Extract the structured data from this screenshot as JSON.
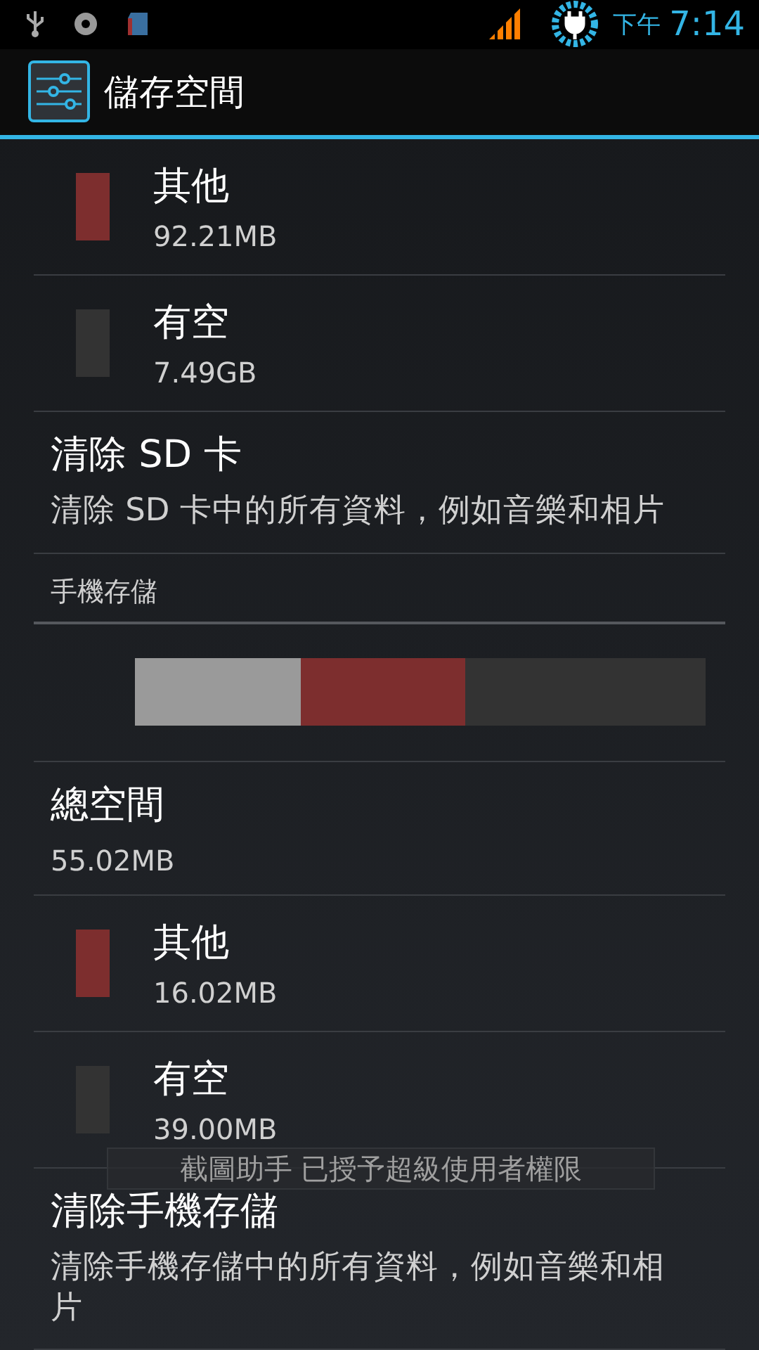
{
  "status_bar": {
    "period": "下午",
    "time": "7:14"
  },
  "action_bar": {
    "title": "儲存空間"
  },
  "items": [
    {
      "kind": "legend",
      "label": "其他",
      "value": "92.21MB",
      "color": "#7d2e2e"
    },
    {
      "kind": "legend",
      "label": "有空",
      "value": "7.49GB",
      "color": "#333333"
    },
    {
      "kind": "action",
      "title": "清除 SD 卡",
      "summary": "清除 SD 卡中的所有資料，例如音樂和相片"
    },
    {
      "kind": "header",
      "title": "手機存儲"
    },
    {
      "kind": "bar",
      "color": "#333333",
      "segments": [
        {
          "color": "#7d2e2e",
          "level": 0.58
        },
        {
          "color": "#9a9a9a",
          "level": 0.29
        }
      ]
    },
    {
      "kind": "total",
      "title": "總空間",
      "value": "55.02MB"
    },
    {
      "kind": "legend",
      "label": "其他",
      "value": "16.02MB",
      "color": "#7d2e2e"
    },
    {
      "kind": "legend",
      "label": "有空",
      "value": "39.00MB",
      "color": "#333333"
    },
    {
      "kind": "action",
      "title": "清除手機存儲",
      "summary": "清除手機存儲中的所有資料，例如音樂和相片"
    }
  ],
  "toast": {
    "text": "截圖助手 已授予超級使用者權限"
  }
}
